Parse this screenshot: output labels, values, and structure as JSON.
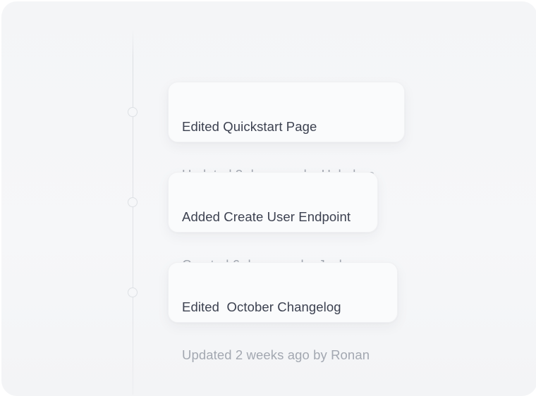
{
  "activity_feed": {
    "items": [
      {
        "title": "Edited Quickstart Page",
        "meta": "Updated 3 days ago by Hahnbee"
      },
      {
        "title": "Added Create User Endpoint",
        "meta": "Created 6 days ago by Josh"
      },
      {
        "title": "Edited  October Changelog",
        "meta": "Updated 2 weeks ago by Ronan"
      }
    ]
  }
}
